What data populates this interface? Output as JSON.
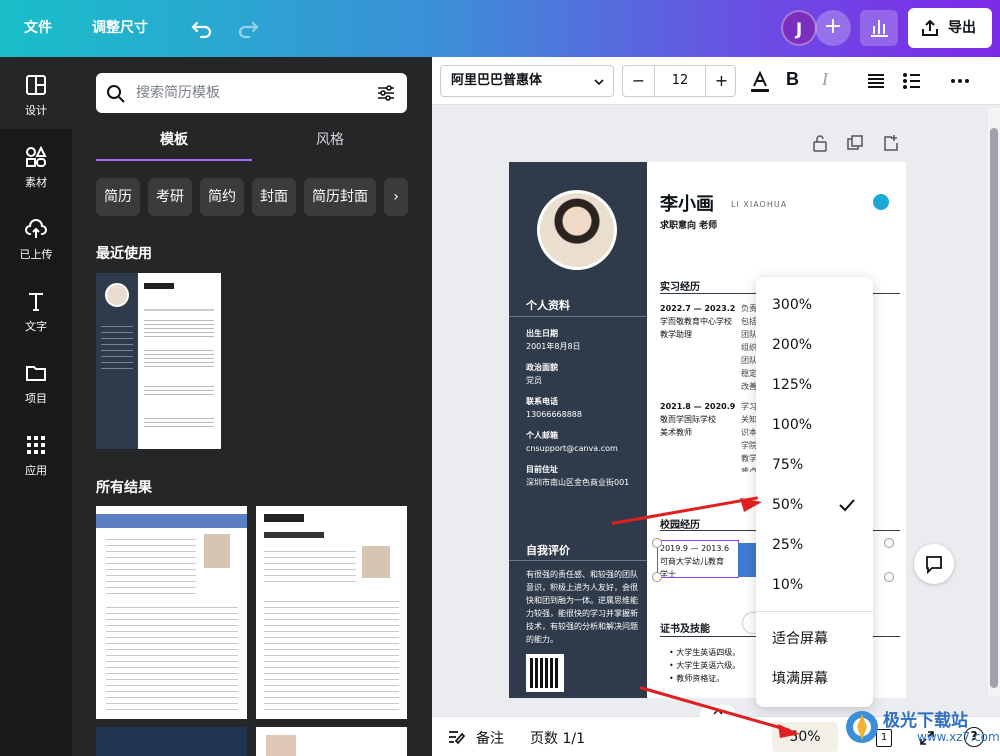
{
  "topbar": {
    "file": "文件",
    "resize": "调整尺寸",
    "avatar": "J",
    "export": "导出"
  },
  "rail": {
    "items": [
      {
        "label": "设计",
        "icon": "design-icon"
      },
      {
        "label": "素材",
        "icon": "elements-icon"
      },
      {
        "label": "已上传",
        "icon": "upload-icon"
      },
      {
        "label": "文字",
        "icon": "text-icon"
      },
      {
        "label": "项目",
        "icon": "folder-icon"
      },
      {
        "label": "应用",
        "icon": "apps-icon"
      }
    ]
  },
  "panel": {
    "search_placeholder": "搜索简历模板",
    "tabs": [
      "模板",
      "风格"
    ],
    "chips": [
      "简历",
      "考研",
      "简约",
      "封面",
      "简历封面"
    ],
    "recent_title": "最近使用",
    "all_title": "所有结果"
  },
  "toolbar": {
    "font": "阿里巴巴普惠体",
    "font_size": "12"
  },
  "resume": {
    "name": "李小画",
    "name_en": "LI XIAOHUA",
    "job": "求职意向 老师",
    "personal_title": "个人资料",
    "fields": [
      {
        "label": "出生日期",
        "value": "2001年8月8日"
      },
      {
        "label": "政治面貌",
        "value": "党员"
      },
      {
        "label": "联系电话",
        "value": "13066668888"
      },
      {
        "label": "个人邮箱",
        "value": "cnsupport@canva.com"
      },
      {
        "label": "目前住址",
        "value": "深圳市南山区金色商业街001"
      }
    ],
    "self_title": "自我评价",
    "self_text": "有很强的责任感、和较强的团队意识，积极上进为人友好，会很快和团到融为一体。逆属思维能力较强，能很快的学习并掌握新技术，有较强的分析和解决问题的能力。",
    "intern_title": "实习经历",
    "jobs": [
      {
        "period": "2022.7 — 2023.2",
        "org": "学而敬教育中心学校",
        "role": "教学助理",
        "desc": "负责包括团队组织团队稳定改善质量解进问题教研教学"
      },
      {
        "period": "2021.8 — 2020.9",
        "org": "敬而学国际学校",
        "role": "美术教师",
        "desc": "学习关知识本学院教学难点并实施课堂"
      }
    ],
    "campus_title": "校园经历",
    "campus_period": "2019.9 — 2013.6",
    "campus_org": "可商大学幼儿教育",
    "campus_role": "学士",
    "cert_title": "证书及技能",
    "certs": [
      "大学生英语四级。",
      "大学生英语六级。",
      "教师资格证。"
    ]
  },
  "zoom_menu": {
    "options": [
      "300%",
      "200%",
      "125%",
      "100%",
      "75%",
      "50%",
      "25%",
      "10%"
    ],
    "selected": "50%",
    "fit": "适合屏幕",
    "fill": "填满屏幕"
  },
  "bottombar": {
    "notes": "备注",
    "pages": "页数 1/1",
    "zoom": "50%",
    "page_num": "1"
  },
  "watermark": {
    "text": "极光下载站",
    "url": "www.xz7.com"
  },
  "colors": {
    "accent": "#8b3dff",
    "sidebar": "#2f3b4a",
    "arrow": "#e02020"
  }
}
